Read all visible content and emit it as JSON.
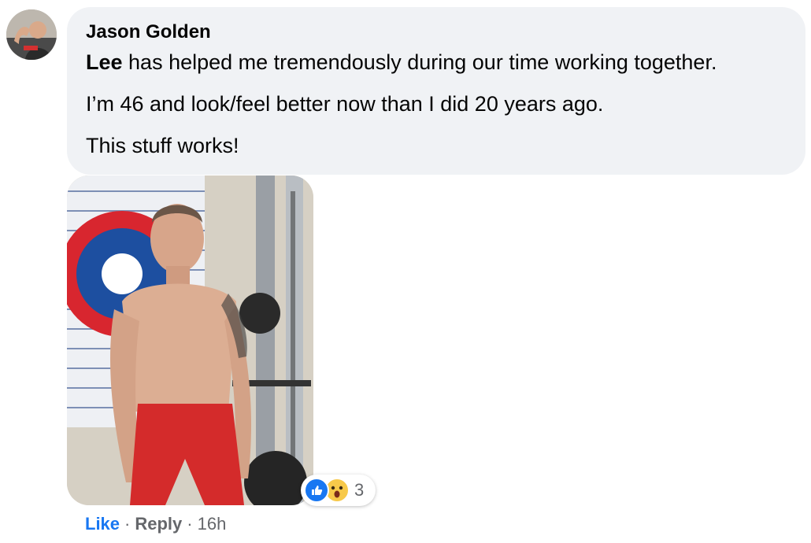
{
  "comment": {
    "author": "Jason Golden",
    "mention": "Lee",
    "lines": [
      " has helped me tremendously during our time working together.",
      "I’m 46 and look/feel better now than I did 20 years ago.",
      "This stuff works!"
    ]
  },
  "reactions": {
    "count": "3",
    "types": [
      "like-icon",
      "wow-icon"
    ]
  },
  "actions": {
    "like": "Like",
    "reply": "Reply",
    "separator": "·",
    "timestamp": "16h"
  },
  "colors": {
    "bubble": "#f0f2f5",
    "link_blue": "#1877f2",
    "meta_gray": "#65676b",
    "text": "#050505"
  }
}
